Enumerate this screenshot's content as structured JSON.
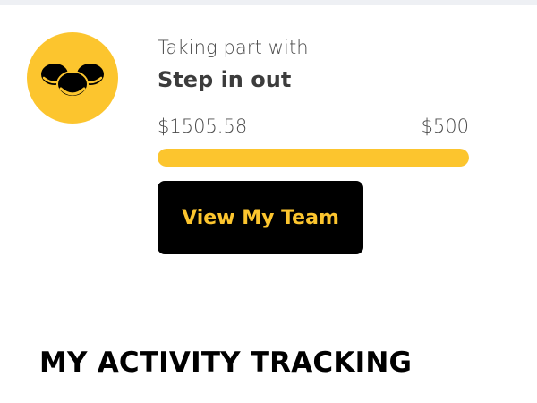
{
  "team_card": {
    "caption": "Taking part with",
    "team_name": "Step in out",
    "amount_raised": "$1505.58",
    "goal": "$500",
    "progress_fraction": 1.0,
    "button_label": "View My Team",
    "avatar_icon": "team-group-icon"
  },
  "activity_section": {
    "title": "MY ACTIVITY TRACKING"
  },
  "colors": {
    "accent": "#fcc52e",
    "button_bg": "#000000",
    "text_dark": "#3c3c3c"
  }
}
